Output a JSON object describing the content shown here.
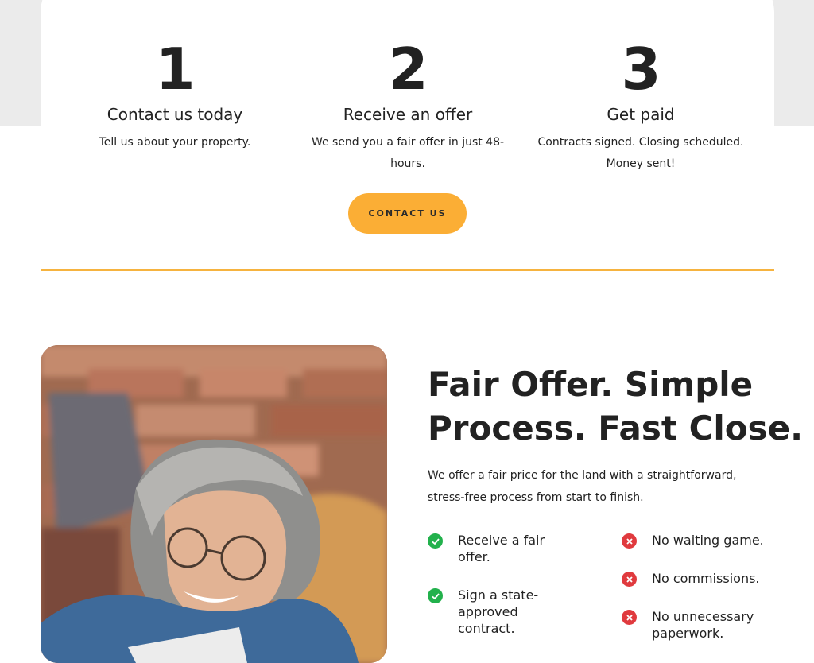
{
  "steps": [
    {
      "number": "1",
      "title": "Contact us today",
      "description": "Tell us about your property."
    },
    {
      "number": "2",
      "title": "Receive an offer",
      "description": "We send you a fair offer in just 48-hours."
    },
    {
      "number": "3",
      "title": "Get paid",
      "description": "Contracts signed. Closing scheduled. Money sent!"
    }
  ],
  "cta": {
    "label": "CONTACT US"
  },
  "section": {
    "heading_line1": "Fair Offer. Simple",
    "heading_line2": "Process. Fast Close.",
    "paragraph": "We offer a fair price for the land with a straightforward, stress-free process from start to finish.",
    "pros": [
      {
        "text": "Receive a fair offer.",
        "icon": "check-circle-icon"
      },
      {
        "text": "Sign a state-approved contract.",
        "icon": "check-circle-icon"
      }
    ],
    "cons": [
      {
        "text": "No waiting game.",
        "icon": "x-circle-icon"
      },
      {
        "text": "No commissions.",
        "icon": "x-circle-icon"
      },
      {
        "text": "No unnecessary paperwork.",
        "icon": "x-circle-icon"
      }
    ]
  },
  "colors": {
    "accent": "#fbae35",
    "divider": "#f6b33f",
    "check": "#22b14c",
    "cross": "#e03a3e",
    "band": "#ebebeb"
  }
}
